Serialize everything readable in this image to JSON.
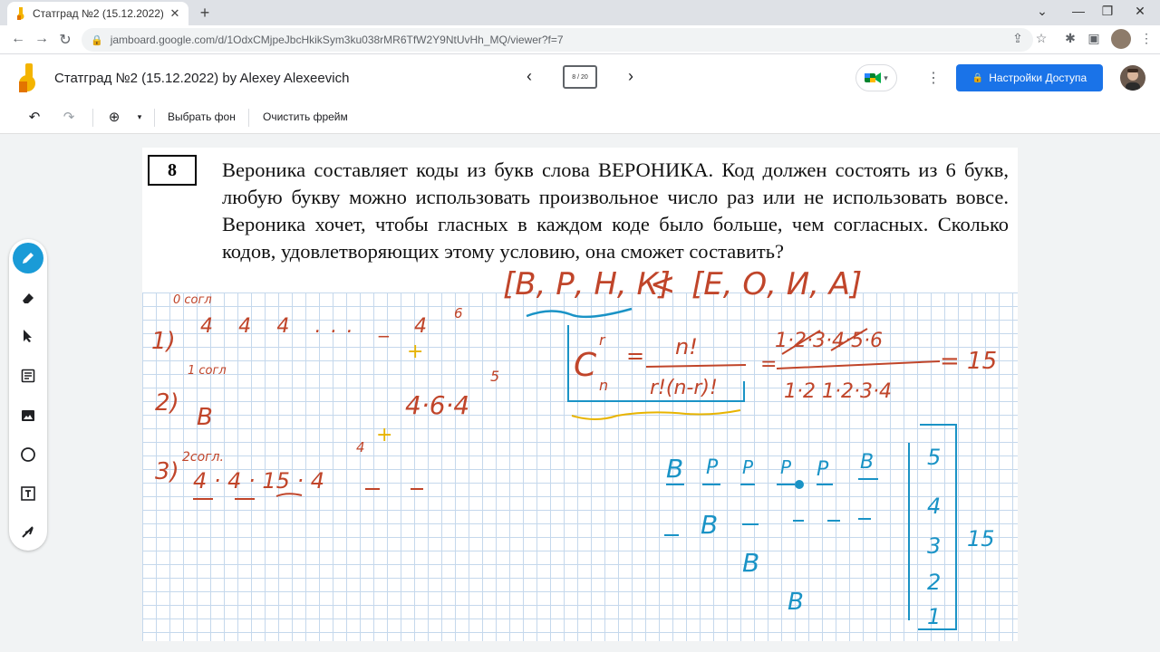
{
  "browser": {
    "tab_title": "Статград №2 (15.12.2022) by Ale",
    "new_tab": "+",
    "url": "jamboard.google.com/d/1OdxCMjpeJbcHkikSym3ku038rMR6TfW2Y9NtUvHh_MQ/viewer?f=7",
    "window_controls": [
      "⌄",
      "—",
      "❐",
      "✕"
    ]
  },
  "app": {
    "title": "Статград №2 (15.12.2022) by Alexey Alexeevich",
    "frame_indicator": "8 / 20",
    "share_label": "Настройки Доступа"
  },
  "toolbar": {
    "set_background": "Выбрать фон",
    "clear_frame": "Очистить фрейм"
  },
  "problem": {
    "number": "8",
    "text": "Вероника составляет коды из букв слова ВЕРОНИКА. Код должен состоять из 6 букв, любую букву можно использовать произвольное число раз или не использовать вовсе. Вероника хочет, чтобы гласных в каждом коде было больше, чем согласных. Сколько кодов, удовлетворяющих этому условию, она сможет составить?"
  },
  "handwriting": {
    "consonants": "[В, Р, Н, К]",
    "lt": "<",
    "vowels": "[Е, О, И, А]",
    "case1_num": "1)",
    "case1_note": "0 согл",
    "case1_row": "4  4  4  ...  _  4",
    "case1_exp": "6",
    "case2_num": "2)",
    "case2_note": "1 согл",
    "case2_letter": "В",
    "case2_expr": "4·6·4",
    "case2_exp": "5",
    "case3_num": "3)",
    "case3_note": "2согл.",
    "case3_expr": "4 · 4 · 15 · 4",
    "case3_exp": "4",
    "plus": "+",
    "comb_C": "C",
    "comb_r": "r",
    "comb_n": "n",
    "comb_eq": "=",
    "comb_num": "n!",
    "comb_den": "r!(n-r)!",
    "comb_calc_top": "1·2·3·4·5·6",
    "comb_calc_bot": "1·2  1·2·3·4",
    "comb_result": "= 15",
    "blue_row1": [
      "В",
      "Р",
      "Р",
      "Р",
      "Р",
      "В"
    ],
    "blue_B": "В",
    "blue_col": [
      "5",
      "4",
      "3",
      "2",
      "1"
    ],
    "blue_total": "15"
  },
  "colors": {
    "accent": "#1a73e8",
    "ink_red": "#c0452a",
    "ink_blue": "#1a93c6",
    "ink_yellow": "#e8b400",
    "grid": "#c5d8ec"
  },
  "icons": [
    "undo-icon",
    "redo-icon",
    "zoom-icon",
    "pen-icon",
    "eraser-icon",
    "select-icon",
    "sticky-note-icon",
    "image-icon",
    "circle-icon",
    "textbox-icon",
    "laser-icon"
  ]
}
